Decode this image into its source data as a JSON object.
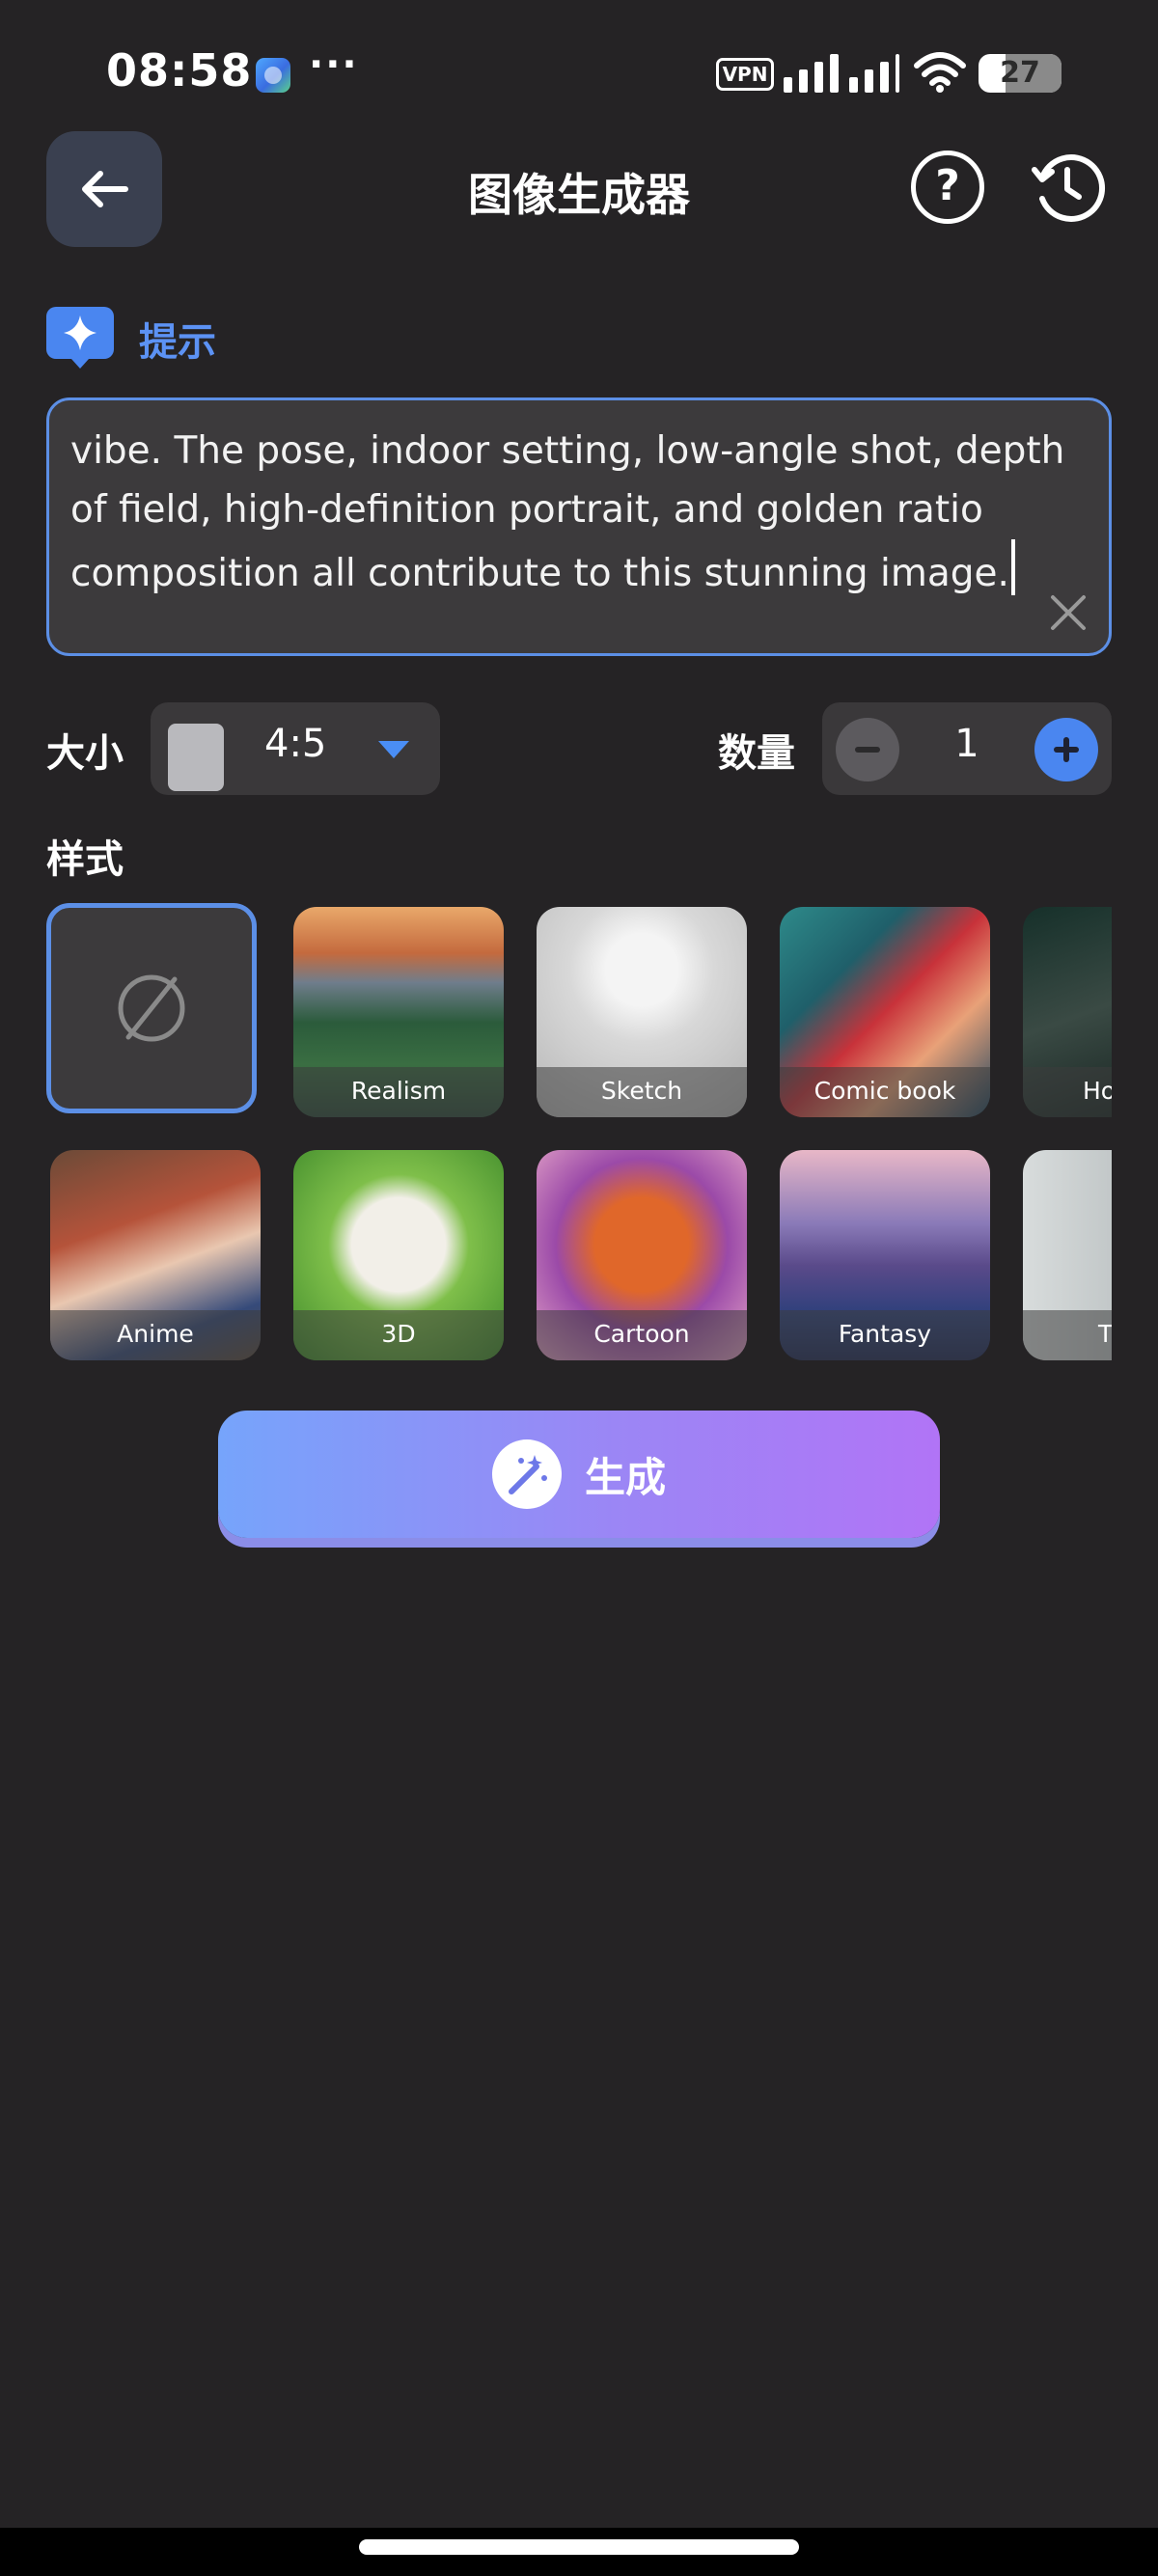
{
  "status_bar": {
    "time": "08:58",
    "more": "···",
    "vpn": "VPN",
    "battery": "27"
  },
  "header": {
    "title": "图像生成器",
    "back_icon": "arrow-left-icon",
    "help_icon": "help-circle-icon",
    "history_icon": "history-clock-icon"
  },
  "prompt": {
    "label": "提示",
    "text": "vibe. The pose, indoor setting, low-angle shot, depth of field, high-definition portrait, and golden ratio composition all contribute to this stunning image."
  },
  "size": {
    "label": "大小",
    "value": "4:5"
  },
  "quantity": {
    "label": "数量",
    "value": "1"
  },
  "styles": {
    "label": "样式",
    "items": [
      {
        "label": "",
        "kind": "none",
        "selected": true
      },
      {
        "label": "Realism"
      },
      {
        "label": "Sketch"
      },
      {
        "label": "Comic book"
      },
      {
        "label": "Ho"
      },
      {
        "label": "Anime"
      },
      {
        "label": "3D"
      },
      {
        "label": "Cartoon"
      },
      {
        "label": "Fantasy"
      },
      {
        "label": "T"
      }
    ]
  },
  "generate": {
    "label": "生成",
    "icon": "magic-wand-icon"
  },
  "colors": {
    "background": "#252325",
    "accent": "#5c8fe6",
    "gradient_start": "#76a4fb",
    "gradient_end": "#b174f6"
  }
}
